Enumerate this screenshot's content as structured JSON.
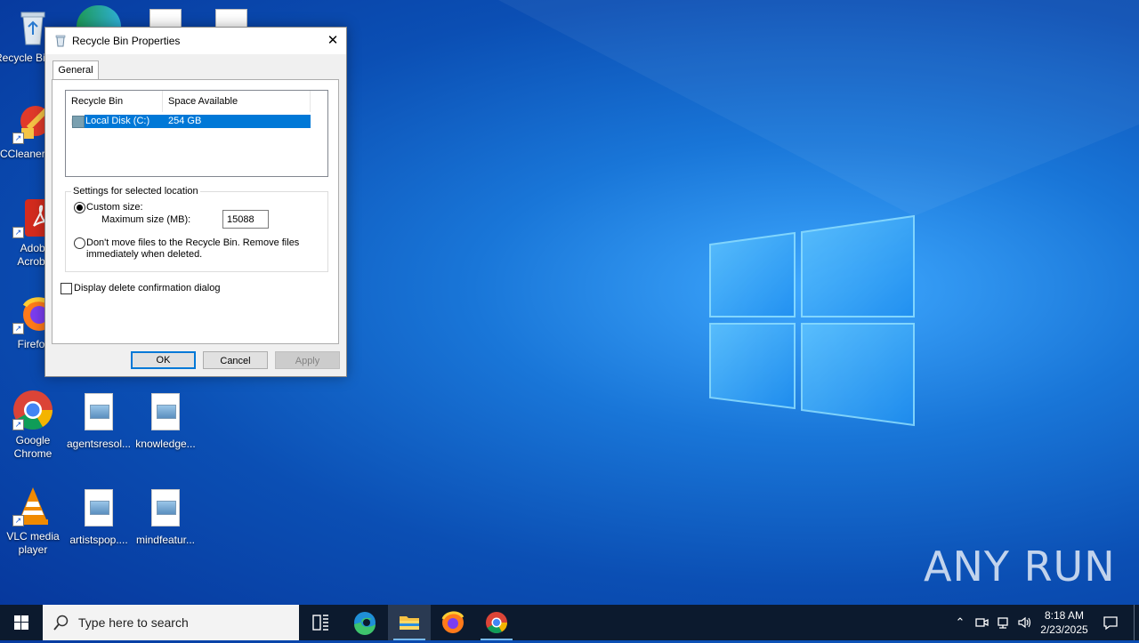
{
  "desktop": {
    "icons": [
      {
        "label": "Recycle Bin",
        "icon": "recycle-bin-icon"
      },
      {
        "label": "CCleaner",
        "icon": "ccleaner-icon"
      },
      {
        "label": "Adobe Acrobat",
        "icon": "adobe-acrobat-icon"
      },
      {
        "label": "Firefox",
        "icon": "firefox-icon"
      },
      {
        "label": "Google Chrome",
        "icon": "chrome-icon"
      },
      {
        "label": "agentsresol...",
        "icon": "image-file-icon"
      },
      {
        "label": "knowledge...",
        "icon": "image-file-icon"
      },
      {
        "label": "VLC media player",
        "icon": "vlc-icon"
      },
      {
        "label": "artistspop....",
        "icon": "image-file-icon"
      },
      {
        "label": "mindfeatur...",
        "icon": "image-file-icon"
      }
    ]
  },
  "dialog": {
    "title": "Recycle Bin Properties",
    "close_glyph": "✕",
    "tabs": [
      {
        "label": "General"
      }
    ],
    "list": {
      "columns": [
        "Recycle Bin Location",
        "Space Available"
      ],
      "rows": [
        {
          "location": "Local Disk (C:)",
          "space": "254 GB",
          "selected": true
        }
      ]
    },
    "settings": {
      "legend": "Settings for selected location",
      "custom_size_label": "Custom size:",
      "max_size_label": "Maximum size (MB):",
      "max_size_value": "15088",
      "dont_move_label_line1": "Don't move files to the Recycle Bin. Remove files",
      "dont_move_label_line2": "immediately when deleted.",
      "custom_selected": true
    },
    "confirm_label": "Display delete confirmation dialog",
    "confirm_checked": false,
    "buttons": {
      "ok": "OK",
      "cancel": "Cancel",
      "apply": "Apply"
    }
  },
  "taskbar": {
    "search_placeholder": "Type here to search",
    "pinned": [
      "task-view-icon",
      "edge-icon",
      "file-explorer-icon",
      "firefox-icon",
      "chrome-icon"
    ],
    "clock": {
      "time": "8:18 AM",
      "date": "2/23/2025"
    }
  },
  "watermark": "ANY RUN",
  "colors": {
    "accent": "#0078d7",
    "taskbar": "#0c1a2e"
  }
}
